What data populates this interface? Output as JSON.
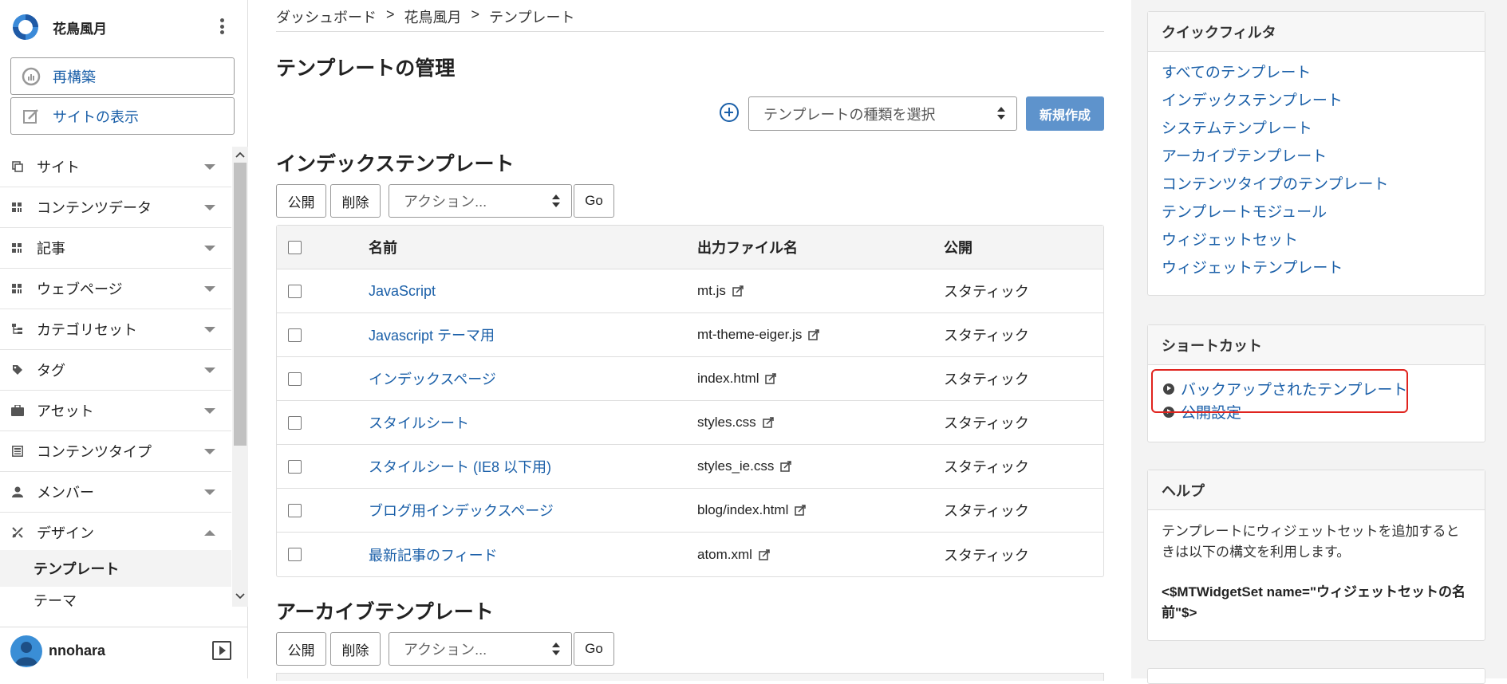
{
  "site": {
    "name": "花鳥風月"
  },
  "sidebar": {
    "rebuild_label": "再構築",
    "view_site_label": "サイトの表示",
    "items": [
      {
        "label": "サイト",
        "icon": "site-icon"
      },
      {
        "label": "コンテンツデータ",
        "icon": "content-data-icon"
      },
      {
        "label": "記事",
        "icon": "entry-icon"
      },
      {
        "label": "ウェブページ",
        "icon": "webpage-icon"
      },
      {
        "label": "カテゴリセット",
        "icon": "category-set-icon"
      },
      {
        "label": "タグ",
        "icon": "tag-icon"
      },
      {
        "label": "アセット",
        "icon": "asset-icon"
      },
      {
        "label": "コンテンツタイプ",
        "icon": "content-type-icon"
      },
      {
        "label": "メンバー",
        "icon": "member-icon"
      },
      {
        "label": "デザイン",
        "icon": "design-icon"
      }
    ],
    "sub_active": "テンプレート",
    "sub_next": "テーマ"
  },
  "user": {
    "name": "nnohara"
  },
  "breadcrumb": [
    "ダッシュボード",
    "花鳥風月",
    "テンプレート"
  ],
  "breadcrumb_sep": ">",
  "page_title": "テンプレートの管理",
  "type_select_placeholder": "テンプレートの種類を選択",
  "new_button": "新規作成",
  "index_section": {
    "title": "インデックステンプレート",
    "publish": "公開",
    "delete": "削除",
    "action": "アクション...",
    "go": "Go",
    "columns": [
      "名前",
      "出力ファイル名",
      "公開"
    ],
    "rows": [
      {
        "name": "JavaScript",
        "file": "mt.js",
        "publish": "スタティック"
      },
      {
        "name": "Javascript テーマ用",
        "file": "mt-theme-eiger.js",
        "publish": "スタティック"
      },
      {
        "name": "インデックスページ",
        "file": "index.html",
        "publish": "スタティック"
      },
      {
        "name": "スタイルシート",
        "file": "styles.css",
        "publish": "スタティック"
      },
      {
        "name": "スタイルシート (IE8 以下用)",
        "file": "styles_ie.css",
        "publish": "スタティック"
      },
      {
        "name": "ブログ用インデックスページ",
        "file": "blog/index.html",
        "publish": "スタティック"
      },
      {
        "name": "最新記事のフィード",
        "file": "atom.xml",
        "publish": "スタティック"
      }
    ]
  },
  "archive_section": {
    "title": "アーカイブテンプレート",
    "publish": "公開",
    "delete": "削除",
    "action": "アクション...",
    "go": "Go"
  },
  "quick_filter": {
    "title": "クイックフィルタ",
    "items": [
      "すべてのテンプレート",
      "インデックステンプレート",
      "システムテンプレート",
      "アーカイブテンプレート",
      "コンテンツタイプのテンプレート",
      "テンプレートモジュール",
      "ウィジェットセット",
      "ウィジェットテンプレート"
    ]
  },
  "shortcut": {
    "title": "ショートカット",
    "items": [
      "バックアップされたテンプレート",
      "公開設定"
    ]
  },
  "help": {
    "title": "ヘルプ",
    "text": "テンプレートにウィジェットセットを追加するときは以下の構文を利用します。",
    "code": "<$MTWidgetSet name=\"ウィジェットセットの名前\"$>"
  },
  "colors": {
    "link": "#1a5fa8",
    "primary_button": "#5e93cc",
    "highlight": "#e0241f"
  }
}
